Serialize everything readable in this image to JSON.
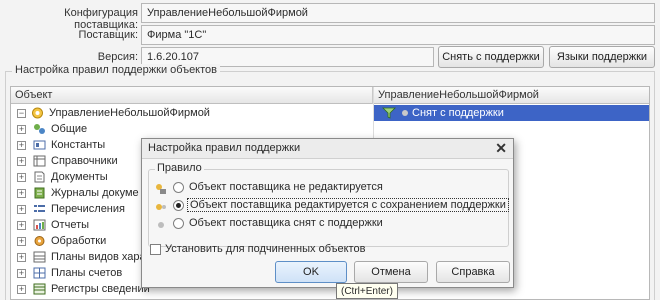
{
  "header": {
    "supplier_config_label": "Конфигурация поставщика:",
    "supplier_config_value": "УправлениеНебольшойФирмой",
    "supplier_label": "Поставщик:",
    "supplier_value": "Фирма \"1С\"",
    "version_label": "Версия:",
    "version_value": "1.6.20.107",
    "remove_support_button": "Снять с поддержки",
    "support_languages_button": "Языки поддержки"
  },
  "rules_group": {
    "title": "Настройка правил поддержки объектов",
    "columns": [
      "Объект",
      "УправлениеНебольшойФирмой"
    ],
    "root": {
      "label": "УправлениеНебольшойФирмой",
      "status": "Снят с поддержки"
    },
    "items": [
      {
        "label": "Общие",
        "icon": "common-icon"
      },
      {
        "label": "Константы",
        "icon": "constants-icon"
      },
      {
        "label": "Справочники",
        "icon": "catalogs-icon"
      },
      {
        "label": "Документы",
        "icon": "documents-icon"
      },
      {
        "label": "Журналы докуме",
        "icon": "journals-icon"
      },
      {
        "label": "Перечисления",
        "icon": "enums-icon"
      },
      {
        "label": "Отчеты",
        "icon": "reports-icon"
      },
      {
        "label": "Обработки",
        "icon": "processing-icon"
      },
      {
        "label": "Планы видов хара",
        "icon": "chart-types-icon"
      },
      {
        "label": "Планы счетов",
        "icon": "chart-accounts-icon"
      },
      {
        "label": "Регистры сведений",
        "icon": "registers-icon"
      }
    ]
  },
  "dialog": {
    "title": "Настройка правил поддержки",
    "group_title": "Правило",
    "options": [
      {
        "label": "Объект поставщика не редактируется",
        "selected": false
      },
      {
        "label": "Объект поставщика редактируется с сохранением поддержки",
        "selected": true
      },
      {
        "label": "Объект поставщика снят с поддержки",
        "selected": false
      }
    ],
    "checkbox_label": "Установить для подчиненных объектов",
    "ok_button": "OK",
    "cancel_button": "Отмена",
    "help_button": "Справка",
    "tooltip": "(Ctrl+Enter)"
  },
  "colors": {
    "selection": "#3d64c6",
    "dialog_border": "#8a8a8a"
  }
}
